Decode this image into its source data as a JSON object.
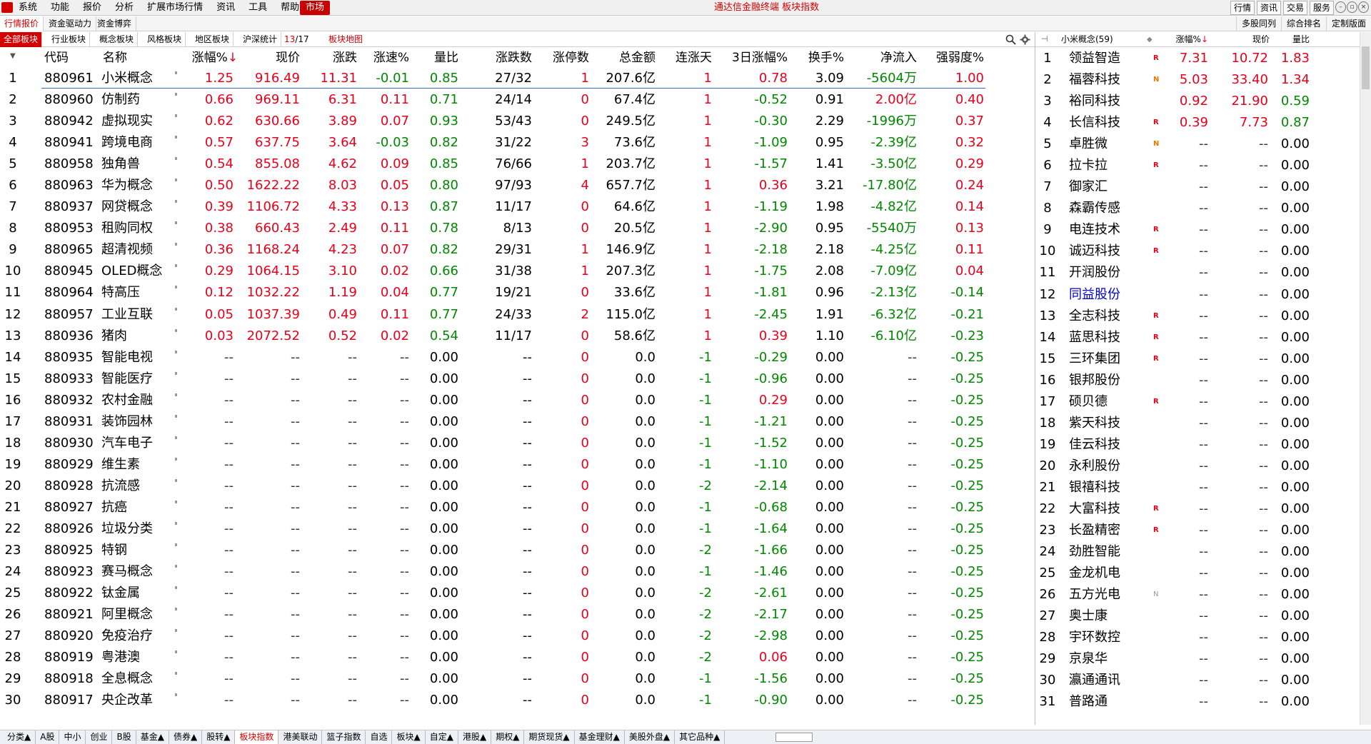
{
  "menu": {
    "items": [
      "系统",
      "功能",
      "报价",
      "分析",
      "扩展市场行情",
      "资讯",
      "工具",
      "帮助"
    ],
    "market": "市场",
    "title": "通达信金融终端  板块指数",
    "right_buttons": [
      "行情",
      "资讯",
      "交易",
      "服务"
    ]
  },
  "tabs1": {
    "items": [
      "行情报价",
      "资金驱动力",
      "资金博弈"
    ],
    "right": [
      "多股同列",
      "综合排名",
      "定制版面"
    ]
  },
  "tabs2": {
    "items": [
      "全部板块",
      "行业板块",
      "概念板块",
      "风格板块",
      "地区板块",
      "沪深统计"
    ],
    "page_current": "13",
    "page_total": "/17",
    "heatmap": "板块地图"
  },
  "main_headers": {
    "code": "代码",
    "name": "名称",
    "pct": "涨幅%",
    "sort_arrow": "↓",
    "price": "现价",
    "chg": "涨跌",
    "speed": "涨速%",
    "volratio": "量比",
    "updown": "涨跌数",
    "limitup": "涨停数",
    "amount": "总金额",
    "streak": "连涨天",
    "pct3d": "3日涨幅%",
    "turnover": "换手%",
    "netflow": "净流入",
    "strength": "强弱度%"
  },
  "rows": [
    [
      "1",
      "880961",
      "小米概念",
      "1.25",
      "916.49",
      "11.31",
      "-0.01",
      "0.85",
      "27/32",
      "1",
      "207.6亿",
      "1",
      "0.78",
      "3.09",
      "-5604万",
      "1.00"
    ],
    [
      "2",
      "880960",
      "仿制药",
      "0.66",
      "969.11",
      "6.31",
      "0.11",
      "0.71",
      "24/14",
      "0",
      "67.4亿",
      "1",
      "-0.52",
      "0.91",
      "2.00亿",
      "0.40"
    ],
    [
      "3",
      "880942",
      "虚拟现实",
      "0.62",
      "630.66",
      "3.89",
      "0.07",
      "0.93",
      "53/43",
      "0",
      "249.5亿",
      "1",
      "-0.30",
      "2.29",
      "-1996万",
      "0.37"
    ],
    [
      "4",
      "880941",
      "跨境电商",
      "0.57",
      "637.75",
      "3.64",
      "-0.03",
      "0.82",
      "31/22",
      "3",
      "73.6亿",
      "1",
      "-1.09",
      "0.95",
      "-2.39亿",
      "0.32"
    ],
    [
      "5",
      "880958",
      "独角兽",
      "0.54",
      "855.08",
      "4.62",
      "0.09",
      "0.85",
      "76/66",
      "1",
      "203.7亿",
      "1",
      "-1.57",
      "1.41",
      "-3.50亿",
      "0.29"
    ],
    [
      "6",
      "880963",
      "华为概念",
      "0.50",
      "1622.22",
      "8.03",
      "0.05",
      "0.80",
      "97/93",
      "4",
      "657.7亿",
      "1",
      "0.36",
      "3.21",
      "-17.80亿",
      "0.24"
    ],
    [
      "7",
      "880937",
      "网贷概念",
      "0.39",
      "1106.72",
      "4.33",
      "0.13",
      "0.87",
      "11/17",
      "0",
      "64.6亿",
      "1",
      "-1.19",
      "1.98",
      "-4.82亿",
      "0.14"
    ],
    [
      "8",
      "880953",
      "租购同权",
      "0.38",
      "660.43",
      "2.49",
      "0.11",
      "0.78",
      "8/13",
      "0",
      "20.5亿",
      "1",
      "-2.90",
      "0.95",
      "-5540万",
      "0.13"
    ],
    [
      "9",
      "880965",
      "超清视频",
      "0.36",
      "1168.24",
      "4.23",
      "0.07",
      "0.82",
      "29/31",
      "1",
      "146.9亿",
      "1",
      "-2.18",
      "2.18",
      "-4.25亿",
      "0.11"
    ],
    [
      "10",
      "880945",
      "OLED概念",
      "0.29",
      "1064.15",
      "3.10",
      "0.02",
      "0.66",
      "31/38",
      "1",
      "207.3亿",
      "1",
      "-1.75",
      "2.08",
      "-7.09亿",
      "0.04"
    ],
    [
      "11",
      "880964",
      "特高压",
      "0.12",
      "1032.22",
      "1.19",
      "0.04",
      "0.77",
      "19/21",
      "0",
      "33.6亿",
      "1",
      "-1.81",
      "0.96",
      "-2.13亿",
      "-0.14"
    ],
    [
      "12",
      "880957",
      "工业互联",
      "0.05",
      "1037.39",
      "0.49",
      "0.11",
      "0.77",
      "24/33",
      "2",
      "115.0亿",
      "1",
      "-2.45",
      "1.91",
      "-6.32亿",
      "-0.21"
    ],
    [
      "13",
      "880936",
      "猪肉",
      "0.03",
      "2072.52",
      "0.52",
      "0.02",
      "0.54",
      "11/17",
      "0",
      "58.6亿",
      "1",
      "0.39",
      "1.10",
      "-6.10亿",
      "-0.23"
    ],
    [
      "14",
      "880935",
      "智能电视",
      "--",
      "--",
      "--",
      "--",
      "0.00",
      "--",
      "0",
      "0.0",
      "-1",
      "-0.29",
      "0.00",
      "--",
      "-0.25"
    ],
    [
      "15",
      "880933",
      "智能医疗",
      "--",
      "--",
      "--",
      "--",
      "0.00",
      "--",
      "0",
      "0.0",
      "-1",
      "-0.96",
      "0.00",
      "--",
      "-0.25"
    ],
    [
      "16",
      "880932",
      "农村金融",
      "--",
      "--",
      "--",
      "--",
      "0.00",
      "--",
      "0",
      "0.0",
      "-1",
      "0.29",
      "0.00",
      "--",
      "-0.25"
    ],
    [
      "17",
      "880931",
      "装饰园林",
      "--",
      "--",
      "--",
      "--",
      "0.00",
      "--",
      "0",
      "0.0",
      "-1",
      "-1.21",
      "0.00",
      "--",
      "-0.25"
    ],
    [
      "18",
      "880930",
      "汽车电子",
      "--",
      "--",
      "--",
      "--",
      "0.00",
      "--",
      "0",
      "0.0",
      "-1",
      "-1.52",
      "0.00",
      "--",
      "-0.25"
    ],
    [
      "19",
      "880929",
      "维生素",
      "--",
      "--",
      "--",
      "--",
      "0.00",
      "--",
      "0",
      "0.0",
      "-1",
      "-1.10",
      "0.00",
      "--",
      "-0.25"
    ],
    [
      "20",
      "880928",
      "抗流感",
      "--",
      "--",
      "--",
      "--",
      "0.00",
      "--",
      "0",
      "0.0",
      "-2",
      "-2.14",
      "0.00",
      "--",
      "-0.25"
    ],
    [
      "21",
      "880927",
      "抗癌",
      "--",
      "--",
      "--",
      "--",
      "0.00",
      "--",
      "0",
      "0.0",
      "-1",
      "-0.68",
      "0.00",
      "--",
      "-0.25"
    ],
    [
      "22",
      "880926",
      "垃圾分类",
      "--",
      "--",
      "--",
      "--",
      "0.00",
      "--",
      "0",
      "0.0",
      "-1",
      "-1.64",
      "0.00",
      "--",
      "-0.25"
    ],
    [
      "23",
      "880925",
      "特钢",
      "--",
      "--",
      "--",
      "--",
      "0.00",
      "--",
      "0",
      "0.0",
      "-2",
      "-1.66",
      "0.00",
      "--",
      "-0.25"
    ],
    [
      "24",
      "880923",
      "赛马概念",
      "--",
      "--",
      "--",
      "--",
      "0.00",
      "--",
      "0",
      "0.0",
      "-1",
      "-1.46",
      "0.00",
      "--",
      "-0.25"
    ],
    [
      "25",
      "880922",
      "钛金属",
      "--",
      "--",
      "--",
      "--",
      "0.00",
      "--",
      "0",
      "0.0",
      "-2",
      "-2.61",
      "0.00",
      "--",
      "-0.25"
    ],
    [
      "26",
      "880921",
      "阿里概念",
      "--",
      "--",
      "--",
      "--",
      "0.00",
      "--",
      "0",
      "0.0",
      "-2",
      "-2.17",
      "0.00",
      "--",
      "-0.25"
    ],
    [
      "27",
      "880920",
      "免疫治疗",
      "--",
      "--",
      "--",
      "--",
      "0.00",
      "--",
      "0",
      "0.0",
      "-2",
      "-2.98",
      "0.00",
      "--",
      "-0.25"
    ],
    [
      "28",
      "880919",
      "粤港澳",
      "--",
      "--",
      "--",
      "--",
      "0.00",
      "--",
      "0",
      "0.0",
      "-2",
      "0.06",
      "0.00",
      "--",
      "-0.25"
    ],
    [
      "29",
      "880918",
      "全息概念",
      "--",
      "--",
      "--",
      "--",
      "0.00",
      "--",
      "0",
      "0.0",
      "-1",
      "-1.56",
      "0.00",
      "--",
      "-0.25"
    ],
    [
      "30",
      "880917",
      "央企改革",
      "--",
      "--",
      "--",
      "--",
      "0.00",
      "--",
      "0",
      "0.0",
      "-1",
      "-0.90",
      "0.00",
      "--",
      "-0.25"
    ]
  ],
  "sub": {
    "title": "小米概念(59)",
    "menu_icon": "◆",
    "headers": {
      "pct": "涨幅%",
      "sort_arrow": "↓",
      "price": "现价",
      "volratio": "量比"
    },
    "rows": [
      [
        "1",
        "领益智造",
        "R",
        "7.31",
        "10.72",
        "1.83"
      ],
      [
        "2",
        "福蓉科技",
        "N",
        "5.03",
        "33.40",
        "1.34"
      ],
      [
        "3",
        "裕同科技",
        "",
        "0.92",
        "21.90",
        "0.59"
      ],
      [
        "4",
        "长信科技",
        "R",
        "0.39",
        "7.73",
        "0.87"
      ],
      [
        "5",
        "卓胜微",
        "N",
        "--",
        "--",
        "0.00"
      ],
      [
        "6",
        "拉卡拉",
        "R",
        "--",
        "--",
        "0.00"
      ],
      [
        "7",
        "御家汇",
        "",
        "--",
        "--",
        "0.00"
      ],
      [
        "8",
        "森霸传感",
        "",
        "--",
        "--",
        "0.00"
      ],
      [
        "9",
        "电连技术",
        "R",
        "--",
        "--",
        "0.00"
      ],
      [
        "10",
        "诚迈科技",
        "R",
        "--",
        "--",
        "0.00"
      ],
      [
        "11",
        "开润股份",
        "",
        "--",
        "--",
        "0.00"
      ],
      [
        "12",
        "同益股份",
        "",
        "--",
        "--",
        "0.00"
      ],
      [
        "13",
        "全志科技",
        "R",
        "--",
        "--",
        "0.00"
      ],
      [
        "14",
        "蓝思科技",
        "R",
        "--",
        "--",
        "0.00"
      ],
      [
        "15",
        "三环集团",
        "R",
        "--",
        "--",
        "0.00"
      ],
      [
        "16",
        "银邦股份",
        "",
        "--",
        "--",
        "0.00"
      ],
      [
        "17",
        "硕贝德",
        "R",
        "--",
        "--",
        "0.00"
      ],
      [
        "18",
        "紫天科技",
        "",
        "--",
        "--",
        "0.00"
      ],
      [
        "19",
        "佳云科技",
        "",
        "--",
        "--",
        "0.00"
      ],
      [
        "20",
        "永利股份",
        "",
        "--",
        "--",
        "0.00"
      ],
      [
        "21",
        "银禧科技",
        "",
        "--",
        "--",
        "0.00"
      ],
      [
        "22",
        "大富科技",
        "R",
        "--",
        "--",
        "0.00"
      ],
      [
        "23",
        "长盈精密",
        "R",
        "--",
        "--",
        "0.00"
      ],
      [
        "24",
        "劲胜智能",
        "",
        "--",
        "--",
        "0.00"
      ],
      [
        "25",
        "金龙机电",
        "",
        "--",
        "--",
        "0.00"
      ],
      [
        "26",
        "五方光电",
        "N",
        "--",
        "--",
        "0.00"
      ],
      [
        "27",
        "奥士康",
        "",
        "--",
        "--",
        "0.00"
      ],
      [
        "28",
        "宇环数控",
        "",
        "--",
        "--",
        "0.00"
      ],
      [
        "29",
        "京泉华",
        "",
        "--",
        "--",
        "0.00"
      ],
      [
        "30",
        "瀛通通讯",
        "",
        "--",
        "--",
        "0.00"
      ],
      [
        "31",
        "普路通",
        "",
        "--",
        "--",
        "0.00"
      ]
    ]
  },
  "bottom_tabs": [
    "分类▲",
    "A股",
    "中小",
    "创业",
    "B股",
    "基金▲",
    "债券▲",
    "股转▲",
    "板块指数",
    "港美联动",
    "篮子指数",
    "自选",
    "板块▲",
    "自定▲",
    "港股▲",
    "期权▲",
    "期货现货▲",
    "基金理财▲",
    "美股外盘▲",
    "其它品种▲"
  ],
  "colors": {
    "up": "#e8001b",
    "down": "#008800",
    "accent": "#d40000",
    "link": "#0000cc"
  }
}
